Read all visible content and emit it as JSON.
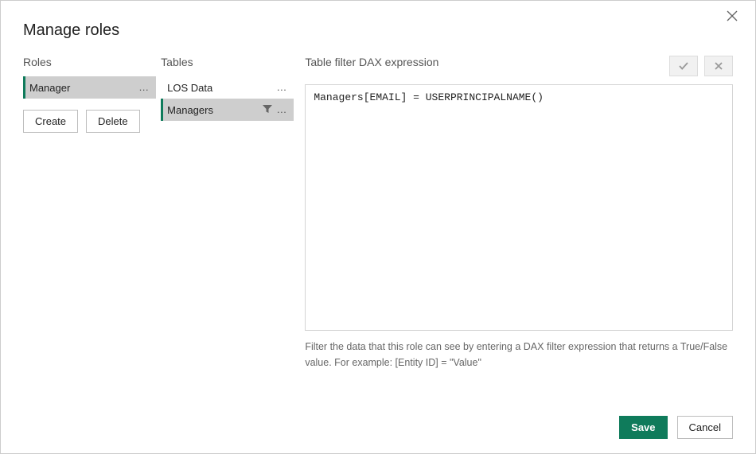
{
  "dialog": {
    "title": "Manage roles"
  },
  "roles": {
    "header": "Roles",
    "items": [
      {
        "label": "Manager",
        "selected": true
      }
    ],
    "create_label": "Create",
    "delete_label": "Delete"
  },
  "tables": {
    "header": "Tables",
    "items": [
      {
        "label": "LOS Data",
        "filtered": false,
        "selected": false
      },
      {
        "label": "Managers",
        "filtered": true,
        "selected": true
      }
    ]
  },
  "filter": {
    "header": "Table filter DAX expression",
    "expression": "Managers[EMAIL] = USERPRINCIPALNAME()",
    "helper": "Filter the data that this role can see by entering a DAX filter expression that returns a True/False value. For example: [Entity ID] = \"Value\""
  },
  "footer": {
    "save_label": "Save",
    "cancel_label": "Cancel"
  }
}
